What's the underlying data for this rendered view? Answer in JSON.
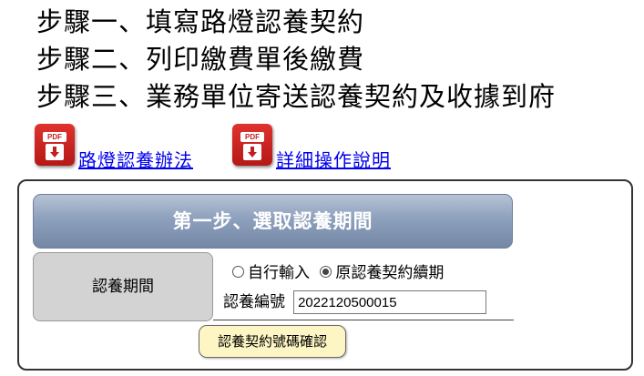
{
  "steps": [
    "步驟一、填寫路燈認養契約",
    "步驟二、列印繳費單後繳費",
    "步驟三、業務單位寄送認養契約及收據到府"
  ],
  "links": [
    {
      "icon": "pdf-icon",
      "icon_label": "PDF",
      "text": "路燈認養辦法"
    },
    {
      "icon": "pdf-icon",
      "icon_label": "PDF",
      "text": "詳細操作說明"
    }
  ],
  "panel": {
    "header": "第一步、選取認養期間",
    "period_label": "認養期間",
    "radio_options": [
      {
        "label": "自行輸入",
        "checked": false
      },
      {
        "label": "原認養契約續期",
        "checked": true
      }
    ],
    "number_label": "認養編號",
    "number_value": "2022120500015",
    "confirm_button": "認養契約號碼確認"
  }
}
